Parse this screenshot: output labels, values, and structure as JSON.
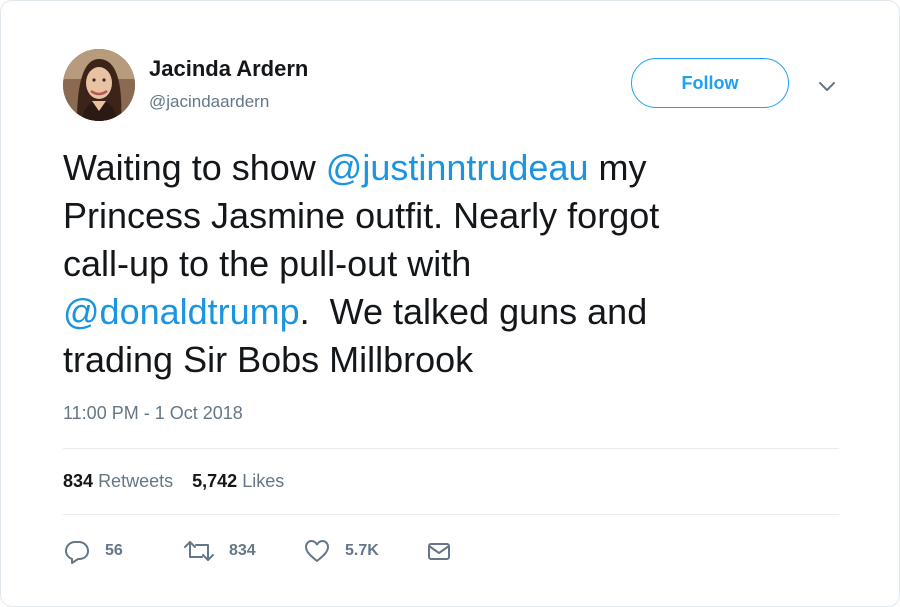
{
  "user": {
    "name": "Jacinda Ardern",
    "handle": "@jacindaardern"
  },
  "follow_label": "Follow",
  "tweet": {
    "lines": [
      [
        "Waiting to show ",
        "@justinntrudeau",
        " my"
      ],
      [
        "Princess Jasmine outfit. Nearly forgot"
      ],
      [
        "call-up to the pull-out with"
      ],
      [
        "@donaldtrump",
        ".  We talked guns and"
      ],
      [
        "trading Sir Bobs Millbrook"
      ]
    ]
  },
  "timestamp": "11:00 PM - 1 Oct 2018",
  "stats": {
    "retweets_count": "834",
    "retweets_label": "Retweets",
    "likes_count": "5,742",
    "likes_label": "Likes"
  },
  "actions": {
    "reply_count": "56",
    "retweet_count": "834",
    "like_count": "5.7K"
  },
  "colors": {
    "accent": "#1da1f2",
    "mention": "#1b95e0",
    "secondary_text": "#657786",
    "primary_text": "#14171a"
  },
  "icons": [
    "avatar-photo",
    "chevron-down-icon",
    "reply-icon",
    "retweet-icon",
    "heart-icon",
    "envelope-icon"
  ]
}
